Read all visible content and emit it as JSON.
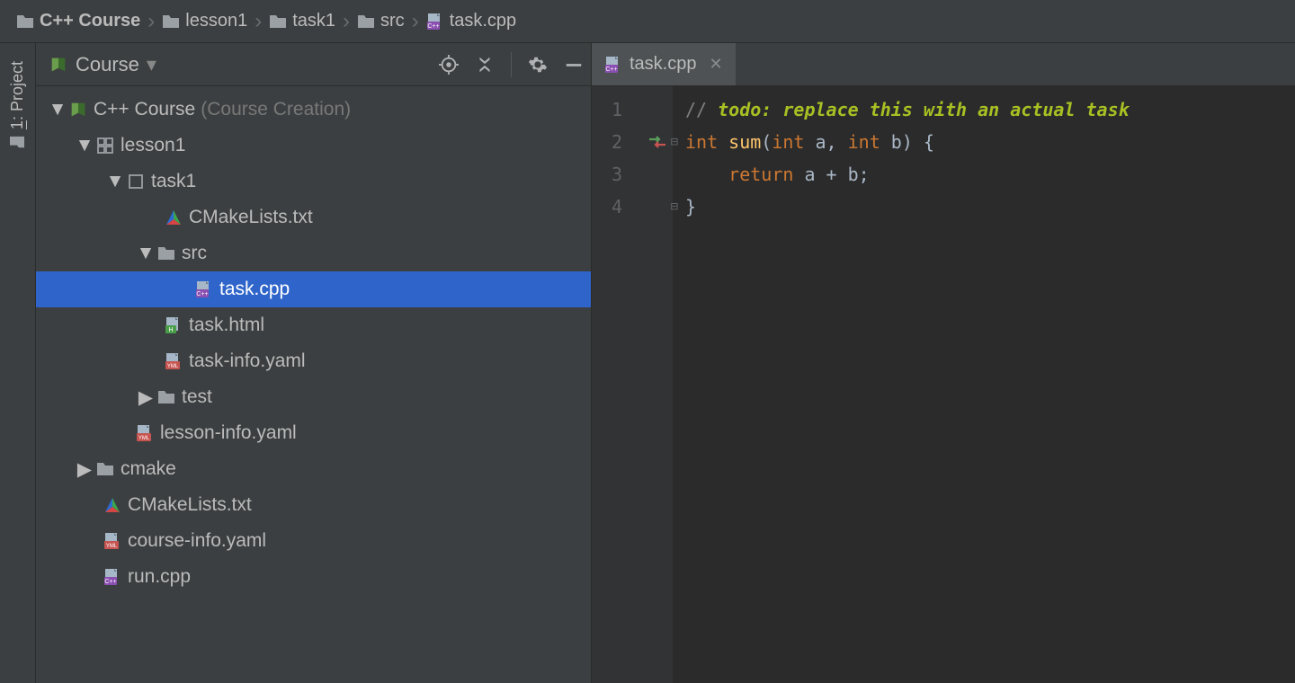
{
  "breadcrumb": [
    {
      "label": "C++ Course",
      "icon": "folder",
      "bold": true
    },
    {
      "label": "lesson1",
      "icon": "folder"
    },
    {
      "label": "task1",
      "icon": "folder"
    },
    {
      "label": "src",
      "icon": "folder"
    },
    {
      "label": "task.cpp",
      "icon": "cpp"
    }
  ],
  "tool_stripe": {
    "project_tab_num": "1",
    "project_tab_label": "Project"
  },
  "panel": {
    "title": "Course"
  },
  "tree": {
    "root": {
      "label": "C++ Course",
      "sub": "(Course Creation)"
    },
    "lesson1": "lesson1",
    "task1": "task1",
    "cmakelists_top": "CMakeLists.txt",
    "src": "src",
    "task_cpp": "task.cpp",
    "task_html": "task.html",
    "task_info_yaml": "task-info.yaml",
    "test": "test",
    "lesson_info_yaml": "lesson-info.yaml",
    "cmake": "cmake",
    "cmakelists_root": "CMakeLists.txt",
    "course_info_yaml": "course-info.yaml",
    "run_cpp": "run.cpp"
  },
  "editor": {
    "tab_label": "task.cpp",
    "lines": [
      "1",
      "2",
      "3",
      "4"
    ],
    "code": {
      "l1_comment_prefix": "// ",
      "l1_todo": "todo: replace this with an actual task",
      "l2_int1": "int",
      "l2_fn": "sum",
      "l2_p_open": "(",
      "l2_int2": "int",
      "l2_a": " a, ",
      "l2_int3": "int",
      "l2_b": " b) {",
      "l3_return": "return",
      "l3_rest": " a + b;",
      "l4": "}"
    }
  }
}
